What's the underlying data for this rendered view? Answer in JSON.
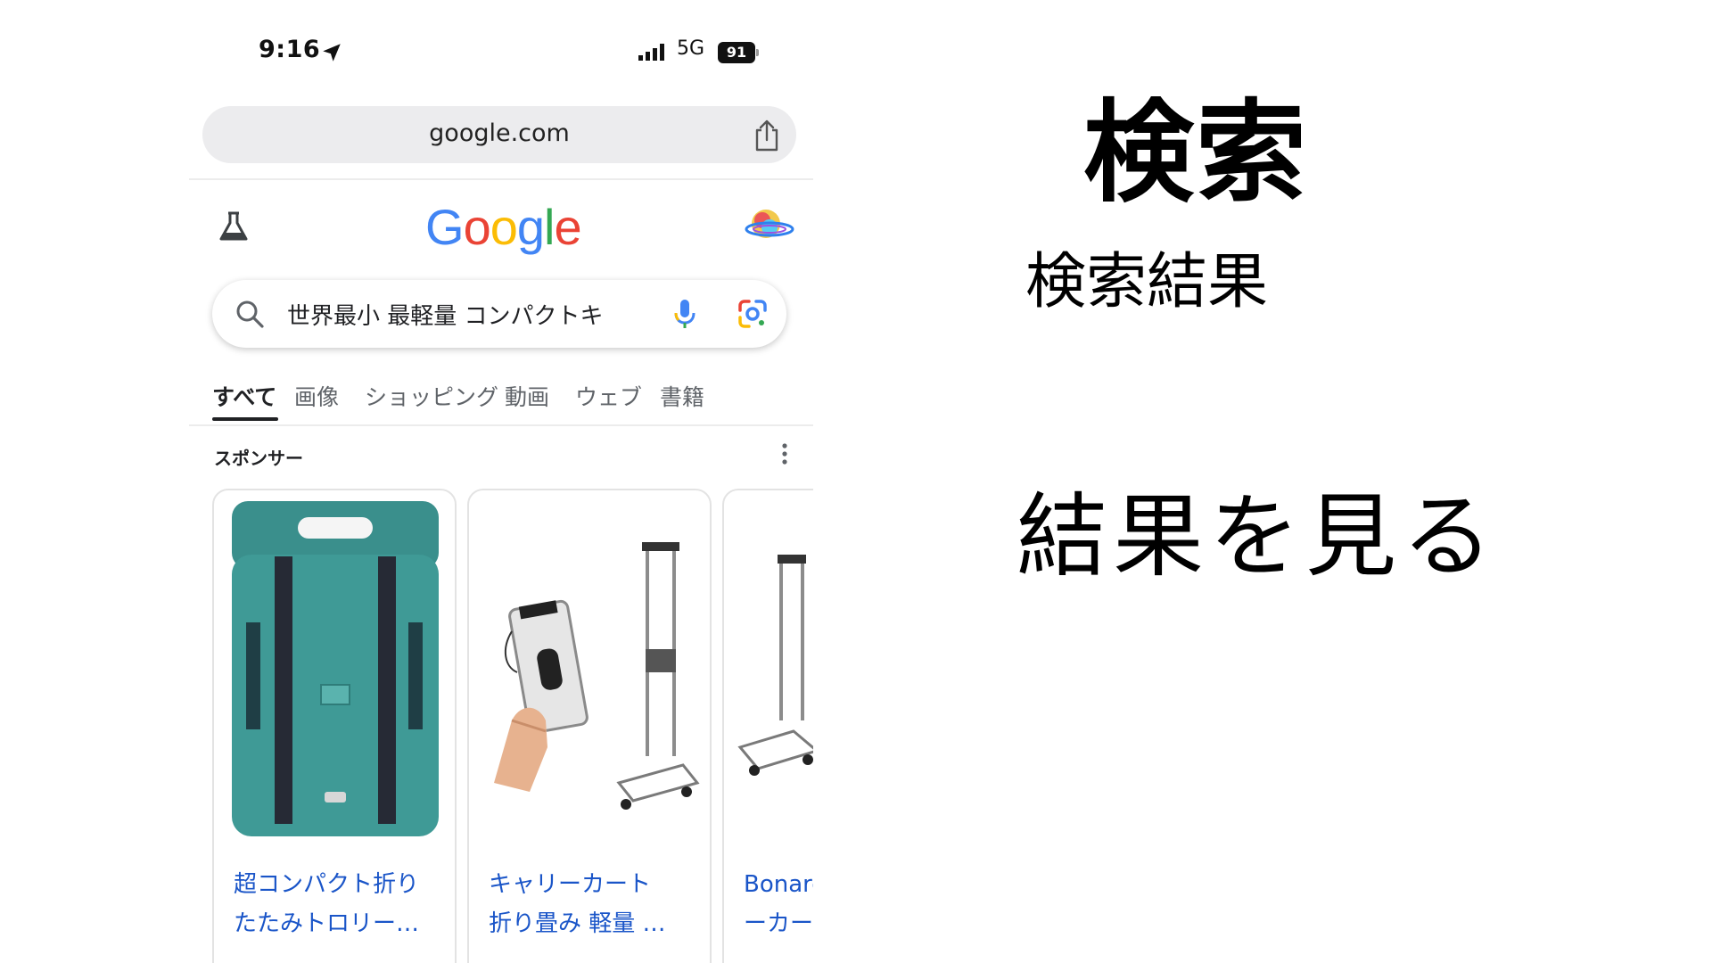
{
  "status_bar": {
    "time": "9:16",
    "network": "5G",
    "battery": "91",
    "icons": [
      "location-arrow-icon",
      "signal-icon",
      "battery-icon"
    ]
  },
  "browser": {
    "url": "google.com",
    "share_icon": "share-icon"
  },
  "google": {
    "logo": [
      "G",
      "o",
      "o",
      "g",
      "l",
      "e"
    ],
    "labs_icon": "flask-icon",
    "avatar": "profile-avatar"
  },
  "search": {
    "query": "世界最小 最軽量 コンパクトキ",
    "icons": [
      "search-icon",
      "microphone-icon",
      "google-lens-icon"
    ]
  },
  "tabs": [
    {
      "label": "すべて",
      "active": true
    },
    {
      "label": "画像"
    },
    {
      "label": "ショッピング"
    },
    {
      "label": "動画"
    },
    {
      "label": "ウェブ"
    },
    {
      "label": "書籍"
    }
  ],
  "sponsored": {
    "label": "スポンサー",
    "more_icon": "more-vert-icon"
  },
  "products": [
    {
      "title_line1": "超コンパクト折り",
      "title_line2": "たたみトロリー…"
    },
    {
      "title_line1": "キャリーカート",
      "title_line2": "折り畳み 軽量 …"
    },
    {
      "title_line1": "Bonarc",
      "title_line2": "ーカー"
    }
  ],
  "slide": {
    "heading": "検索",
    "subheading": "検索結果",
    "cta": "結果を見る"
  },
  "colors": {
    "link_blue": "#1a55c8",
    "google_blue": "#4285f4",
    "google_red": "#ea4335",
    "google_yellow": "#fbbc05",
    "google_green": "#34a853",
    "product_teal": "#3f9a96"
  }
}
